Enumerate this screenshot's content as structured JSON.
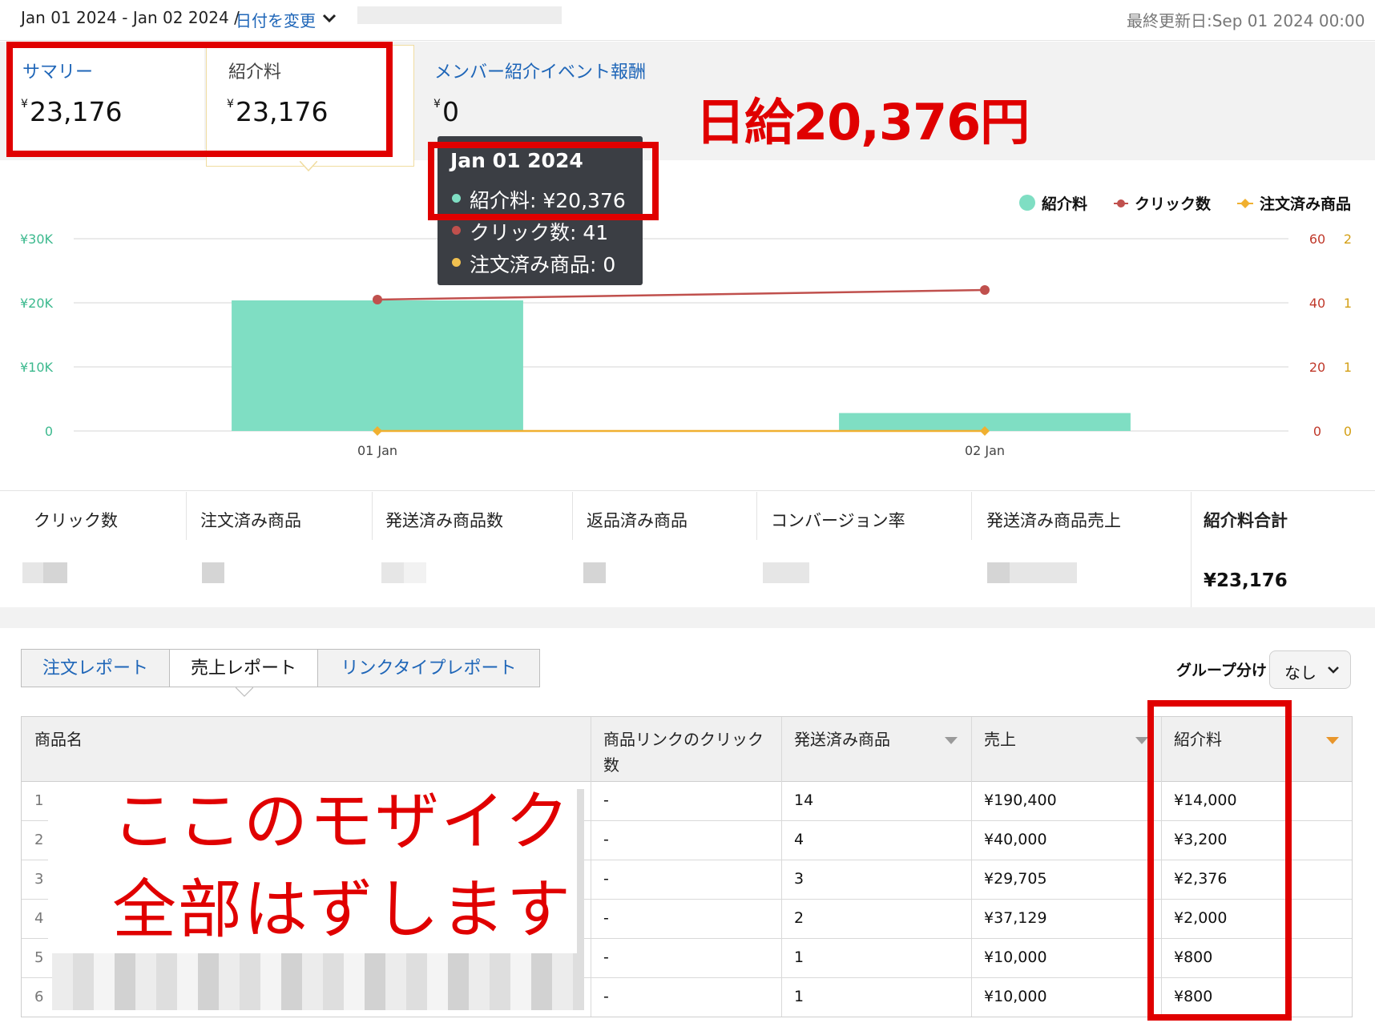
{
  "header": {
    "date_range": "Jan 01 2024 - Jan 02 2024 /",
    "change_date": "日付を変更",
    "last_updated": "最終更新日:Sep 01 2024 00:00"
  },
  "summary": {
    "tabs": [
      {
        "label": "サマリー",
        "value": "23,176"
      },
      {
        "label": "紹介料",
        "value": "23,176"
      },
      {
        "label": "メンバー紹介イベント報酬",
        "value": "0"
      }
    ],
    "yen_mark": "¥",
    "annotation": "日給20,376円"
  },
  "tooltip": {
    "date": "Jan 01 2024",
    "lines": [
      "紹介料: ¥20,376",
      "クリック数: 41",
      "注文済み商品: 0"
    ],
    "colors": [
      "#7fdec3",
      "#c0504d",
      "#f0c050"
    ]
  },
  "chart_data": {
    "type": "bar",
    "categories": [
      "01 Jan",
      "02 Jan"
    ],
    "series": [
      {
        "name": "紹介料",
        "type": "bar",
        "values": [
          20376,
          2800
        ],
        "axis": "left",
        "color": "#7fdec3"
      },
      {
        "name": "クリック数",
        "type": "line",
        "values": [
          41,
          44
        ],
        "axis": "right1",
        "color": "#c0504d"
      },
      {
        "name": "注文済み商品",
        "type": "line",
        "values": [
          0,
          0
        ],
        "axis": "right2",
        "color": "#f0b030"
      }
    ],
    "left_axis": {
      "ticks": [
        "¥30K",
        "¥20K",
        "¥10K",
        "0"
      ],
      "ylim": [
        0,
        30000
      ],
      "color": "#3cb98e"
    },
    "right_axis_1": {
      "ticks": [
        "60",
        "40",
        "20",
        "0"
      ],
      "ylim": [
        0,
        60
      ],
      "color": "#c0392b"
    },
    "right_axis_2": {
      "ticks": [
        "2",
        "1",
        "1",
        "0"
      ],
      "color": "#d4a017"
    },
    "legend": [
      "紹介料",
      "クリック数",
      "注文済み商品"
    ],
    "legend_position": "top-right",
    "grid": true
  },
  "metrics": {
    "labels": [
      "クリック数",
      "注文済み商品",
      "発送済み商品数",
      "返品済み商品",
      "コンバージョン率",
      "発送済み商品売上",
      "紹介料合計"
    ],
    "total_value": "¥23,176"
  },
  "report": {
    "tabs": [
      "注文レポート",
      "売上レポート",
      "リンクタイプレポート"
    ],
    "group_label": "グループ分け",
    "group_value": "なし",
    "columns": [
      "商品名",
      "商品リンクのクリック数",
      "発送済み商品",
      "売上",
      "紹介料"
    ],
    "rows": [
      {
        "num": "1",
        "clicks": "-",
        "shipped": "14",
        "sales": "¥190,400",
        "fee": "¥14,000"
      },
      {
        "num": "2",
        "clicks": "-",
        "shipped": "4",
        "sales": "¥40,000",
        "fee": "¥3,200"
      },
      {
        "num": "3",
        "clicks": "-",
        "shipped": "3",
        "sales": "¥29,705",
        "fee": "¥2,376"
      },
      {
        "num": "4",
        "clicks": "-",
        "shipped": "2",
        "sales": "¥37,129",
        "fee": "¥2,000"
      },
      {
        "num": "5",
        "clicks": "-",
        "shipped": "1",
        "sales": "¥10,000",
        "fee": "¥800"
      },
      {
        "num": "6",
        "clicks": "-",
        "shipped": "1",
        "sales": "¥10,000",
        "fee": "¥800"
      }
    ],
    "annotation_line1": "ここのモザイク",
    "annotation_line2": "全部はずします"
  }
}
